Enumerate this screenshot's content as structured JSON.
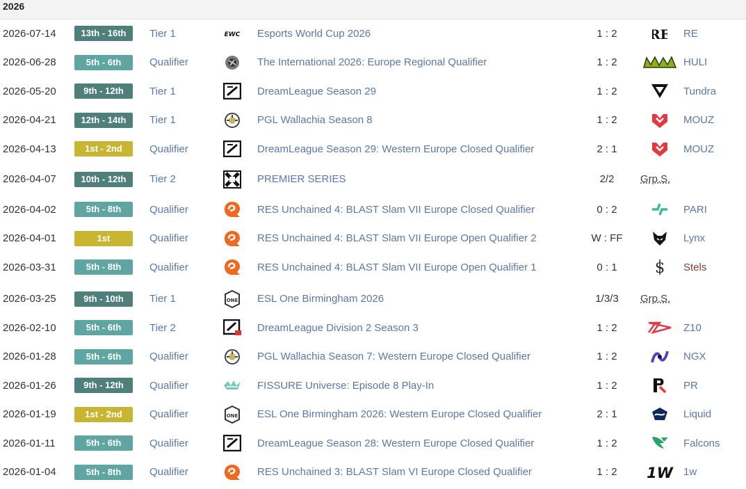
{
  "year": "2026",
  "rows": [
    {
      "date": "2026-07-14",
      "placement": "13th - 16th",
      "place_color": "dark",
      "tier": "Tier 1",
      "tournament": "Esports World Cup 2026",
      "tournament_icon": "ewc-logo-icon",
      "score": "1 : 2",
      "opponent": "RE",
      "opponent_icon": "re-team-logo-icon",
      "opponent_style": "link"
    },
    {
      "date": "2026-06-28",
      "placement": "5th - 6th",
      "place_color": "mid",
      "tier": "Qualifier",
      "tournament": "The International 2026: Europe Regional Qualifier",
      "tournament_icon": "the-international-logo-icon",
      "score": "1 : 2",
      "opponent": "HULI",
      "opponent_icon": "huli-team-logo-icon",
      "opponent_style": "link"
    },
    {
      "date": "2026-05-20",
      "placement": "9th - 12th",
      "place_color": "dark",
      "tier": "Tier 1",
      "tournament": "DreamLeague Season 29",
      "tournament_icon": "dreamleague-logo-icon",
      "score": "1 : 2",
      "opponent": "Tundra",
      "opponent_icon": "tundra-team-logo-icon",
      "opponent_style": "link"
    },
    {
      "date": "2026-04-21",
      "placement": "12th - 14th",
      "place_color": "dark",
      "tier": "Tier 1",
      "tournament": "PGL Wallachia Season 8",
      "tournament_icon": "pgl-wallachia-logo-icon",
      "score": "1 : 2",
      "opponent": "MOUZ",
      "opponent_icon": "mouz-team-logo-icon",
      "opponent_style": "link"
    },
    {
      "date": "2026-04-13",
      "placement": "1st - 2nd",
      "place_color": "gold",
      "tier": "Qualifier",
      "tournament": "DreamLeague Season 29: Western Europe Closed Qualifier",
      "tournament_icon": "dreamleague-logo-icon",
      "score": "2 : 1",
      "opponent": "MOUZ",
      "opponent_icon": "mouz-team-logo-icon",
      "opponent_style": "link"
    },
    {
      "date": "2026-04-07",
      "placement": "10th - 12th",
      "place_color": "dark",
      "tier": "Tier 2",
      "tournament": "PREMIER SERIES",
      "tournament_icon": "premier-series-logo-icon",
      "score": "2/2",
      "opponent": "Grp.S.",
      "opponent_icon": "",
      "opponent_style": "grp"
    },
    {
      "date": "2026-04-02",
      "placement": "5th - 8th",
      "place_color": "mid",
      "tier": "Qualifier",
      "tournament": "RES Unchained 4: BLAST Slam VII Europe Closed Qualifier",
      "tournament_icon": "res-unchained-logo-icon",
      "score": "0 : 2",
      "opponent": "PARI",
      "opponent_icon": "pari-team-logo-icon",
      "opponent_style": "link"
    },
    {
      "date": "2026-04-01",
      "placement": "1st",
      "place_color": "gold",
      "tier": "Qualifier",
      "tournament": "RES Unchained 4: BLAST Slam VII Europe Open Qualifier 2",
      "tournament_icon": "res-unchained-logo-icon",
      "score": "W : FF",
      "opponent": "Lynx",
      "opponent_icon": "lynx-team-logo-icon",
      "opponent_style": "link"
    },
    {
      "date": "2026-03-31",
      "placement": "5th - 8th",
      "place_color": "mid",
      "tier": "Qualifier",
      "tournament": "RES Unchained 4: BLAST Slam VII Europe Open Qualifier 1",
      "tournament_icon": "res-unchained-logo-icon",
      "score": "0 : 1",
      "opponent": "Stels",
      "opponent_icon": "stels-team-logo-icon",
      "opponent_style": "red"
    },
    {
      "date": "2026-03-25",
      "placement": "9th - 10th",
      "place_color": "dark",
      "tier": "Tier 1",
      "tournament": "ESL One Birmingham 2026",
      "tournament_icon": "esl-one-logo-icon",
      "score": "1/3/3",
      "opponent": "Grp.S.",
      "opponent_icon": "",
      "opponent_style": "grp"
    },
    {
      "date": "2026-02-10",
      "placement": "5th - 6th",
      "place_color": "mid",
      "tier": "Tier 2",
      "tournament": "DreamLeague Division 2 Season 3",
      "tournament_icon": "dreamleague-division2-logo-icon",
      "score": "1 : 2",
      "opponent": "Z10",
      "opponent_icon": "z10-team-logo-icon",
      "opponent_style": "link"
    },
    {
      "date": "2026-01-28",
      "placement": "5th - 6th",
      "place_color": "mid",
      "tier": "Qualifier",
      "tournament": "PGL Wallachia Season 7: Western Europe Closed Qualifier",
      "tournament_icon": "pgl-wallachia-logo-icon",
      "score": "1 : 2",
      "opponent": "NGX",
      "opponent_icon": "ngx-team-logo-icon",
      "opponent_style": "link"
    },
    {
      "date": "2026-01-26",
      "placement": "9th - 12th",
      "place_color": "dark",
      "tier": "Qualifier",
      "tournament": "FISSURE Universe: Episode 8 Play-In",
      "tournament_icon": "fissure-logo-icon",
      "score": "1 : 2",
      "opponent": "PR",
      "opponent_icon": "pr-team-logo-icon",
      "opponent_style": "link"
    },
    {
      "date": "2026-01-19",
      "placement": "1st - 2nd",
      "place_color": "gold",
      "tier": "Qualifier",
      "tournament": "ESL One Birmingham 2026: Western Europe Closed Qualifier",
      "tournament_icon": "esl-one-logo-icon",
      "score": "2 : 1",
      "opponent": "Liquid",
      "opponent_icon": "liquid-team-logo-icon",
      "opponent_style": "link"
    },
    {
      "date": "2026-01-11",
      "placement": "5th - 6th",
      "place_color": "mid",
      "tier": "Qualifier",
      "tournament": "DreamLeague Season 28: Western Europe Closed Qualifier",
      "tournament_icon": "dreamleague-logo-icon",
      "score": "1 : 2",
      "opponent": "Falcons",
      "opponent_icon": "falcons-team-logo-icon",
      "opponent_style": "link"
    },
    {
      "date": "2026-01-04",
      "placement": "5th - 8th",
      "place_color": "mid",
      "tier": "Qualifier",
      "tournament": "RES Unchained 3: BLAST Slam VI Europe Closed Qualifier",
      "tournament_icon": "res-unchained-logo-icon",
      "score": "1 : 2",
      "opponent": "1w",
      "opponent_icon": "1w-team-logo-icon",
      "opponent_style": "link"
    }
  ]
}
